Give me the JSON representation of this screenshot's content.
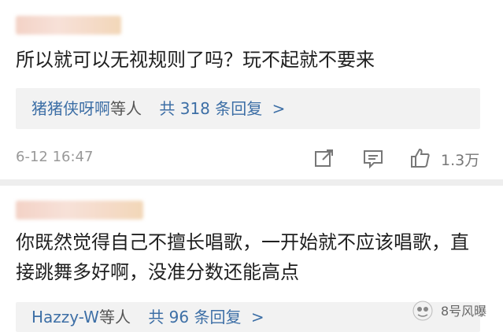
{
  "comments": [
    {
      "text": "所以就可以无视规则了吗？玩不起就不要来",
      "replies": {
        "who": "猪猪侠呀啊",
        "who_suffix": "等人",
        "count": "共 318 条回复",
        "arrow": ">"
      },
      "time": "6-12 16:47",
      "likes": "1.3万"
    },
    {
      "text": "你既然觉得自己不擅长唱歌，一开始就不应该唱歌，直接跳舞多好啊，没准分数还能高点",
      "replies": {
        "who": "Hazzy-W",
        "who_suffix": "等人",
        "count": "共 96 条回复",
        "arrow": ">"
      }
    }
  ],
  "watermark": {
    "text": "8号风曝"
  },
  "icons": [
    "share-icon",
    "comment-icon",
    "like-icon",
    "watermark-logo-icon"
  ]
}
